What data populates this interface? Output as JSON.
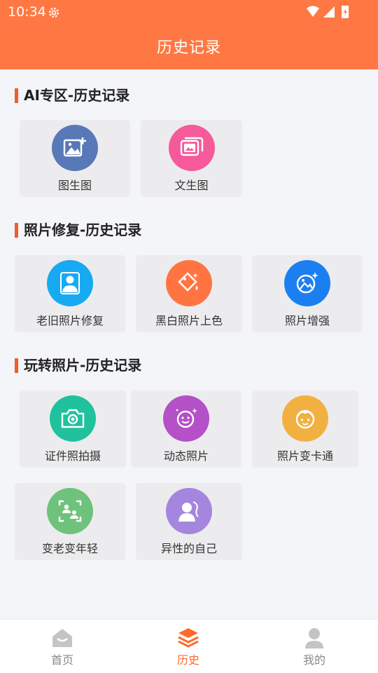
{
  "status": {
    "time": "10:34"
  },
  "header": {
    "title": "历史记录"
  },
  "sections": [
    {
      "title": "AI专区-历史记录",
      "items": [
        {
          "label": "图生图",
          "icon": "image-add-icon",
          "color": "#5878b8"
        },
        {
          "label": "文生图",
          "icon": "images-icon",
          "color": "#f65a9a"
        }
      ]
    },
    {
      "title": "照片修复-历史记录",
      "items": [
        {
          "label": "老旧照片修复",
          "icon": "person-portrait-icon",
          "color": "#17aaf2"
        },
        {
          "label": "黑白照片上色",
          "icon": "paint-bucket-icon",
          "color": "#ff7441"
        },
        {
          "label": "照片增强",
          "icon": "image-sparkle-icon",
          "color": "#1b7ff2"
        }
      ]
    },
    {
      "title": "玩转照片-历史记录",
      "items": [
        {
          "label": "证件照拍摄",
          "icon": "camera-icon",
          "color": "#1fc29d"
        },
        {
          "label": "动态照片",
          "icon": "smiley-planet-icon",
          "color": "#b450c8"
        },
        {
          "label": "照片变卡通",
          "icon": "cartoon-face-icon",
          "color": "#f2b040"
        },
        {
          "label": "变老变年轻",
          "icon": "face-scan-icon",
          "color": "#6fc27c"
        },
        {
          "label": "异性的自己",
          "icon": "gender-profile-icon",
          "color": "#a486de"
        }
      ]
    }
  ],
  "bottom_nav": {
    "tabs": [
      {
        "label": "首页",
        "icon": "home-icon"
      },
      {
        "label": "历史",
        "icon": "layers-icon",
        "active": true
      },
      {
        "label": "我的",
        "icon": "user-icon"
      }
    ],
    "active_color": "#ff6a2c",
    "inactive_color": "#888888"
  },
  "colors": {
    "header_bg": "#ff7843",
    "accent_bar": "#ef5c2d"
  }
}
